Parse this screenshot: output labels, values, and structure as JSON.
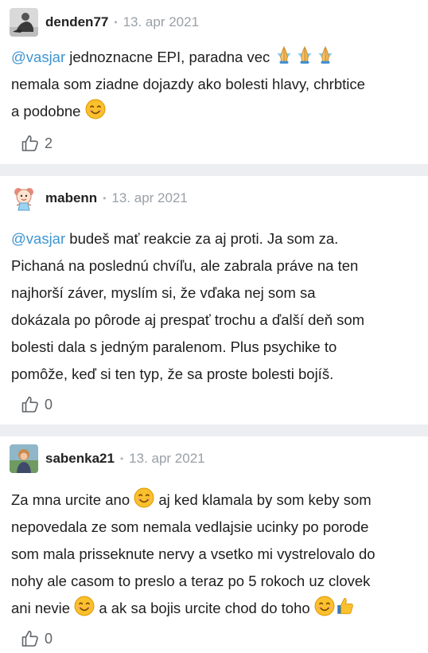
{
  "comments": [
    {
      "username": "denden77",
      "date": "13. apr 2021",
      "mention": "@vasjar",
      "text_a": " jednoznacne EPI, paradna vec ",
      "text_b": "nemala som ziadne dojazdy ako bolesti hlavy, chrbtice",
      "text_c": "a podobne ",
      "likes": "2"
    },
    {
      "username": "mabenn",
      "date": "13. apr 2021",
      "mention": "@vasjar",
      "text_a": " budeš mať reakcie za aj proti. Ja som za.",
      "text_b": "Pichaná na poslednú chvíľu, ale zabrala práve na ten",
      "text_c": "najhorší záver, myslím si, že vďaka nej som sa",
      "text_d": "dokázala po pôrode aj prespať trochu a ďalší deň som",
      "text_e": "bolesti dala s jedným paralenom. Plus psychike to",
      "text_f": "pomôže, keď si ten typ, že sa proste bolesti bojíš.",
      "likes": "0"
    },
    {
      "username": "sabenka21",
      "date": "13. apr 2021",
      "text_a": "Za mna urcite ano ",
      "text_a2": " aj ked klamala by som keby som",
      "text_b": "nepovedala ze som nemala vedlajsie ucinky po porode",
      "text_c": "som mala prisseknute nervy a vsetko mi vystrelovalo do",
      "text_d": "nohy ale casom to preslo a teraz po 5 rokoch uz clovek",
      "text_e": "ani nevie ",
      "text_e2": " a ak sa bojis urcite chod do toho ",
      "likes": "0"
    }
  ],
  "separator": "•",
  "icons": [
    "thumbs-up-icon",
    "smile-emoji",
    "pray-emoji",
    "thumbs-up-emoji"
  ],
  "colors": {
    "mention": "#3d95d2",
    "date": "#9aa0a6",
    "separator": "#eceef1"
  }
}
